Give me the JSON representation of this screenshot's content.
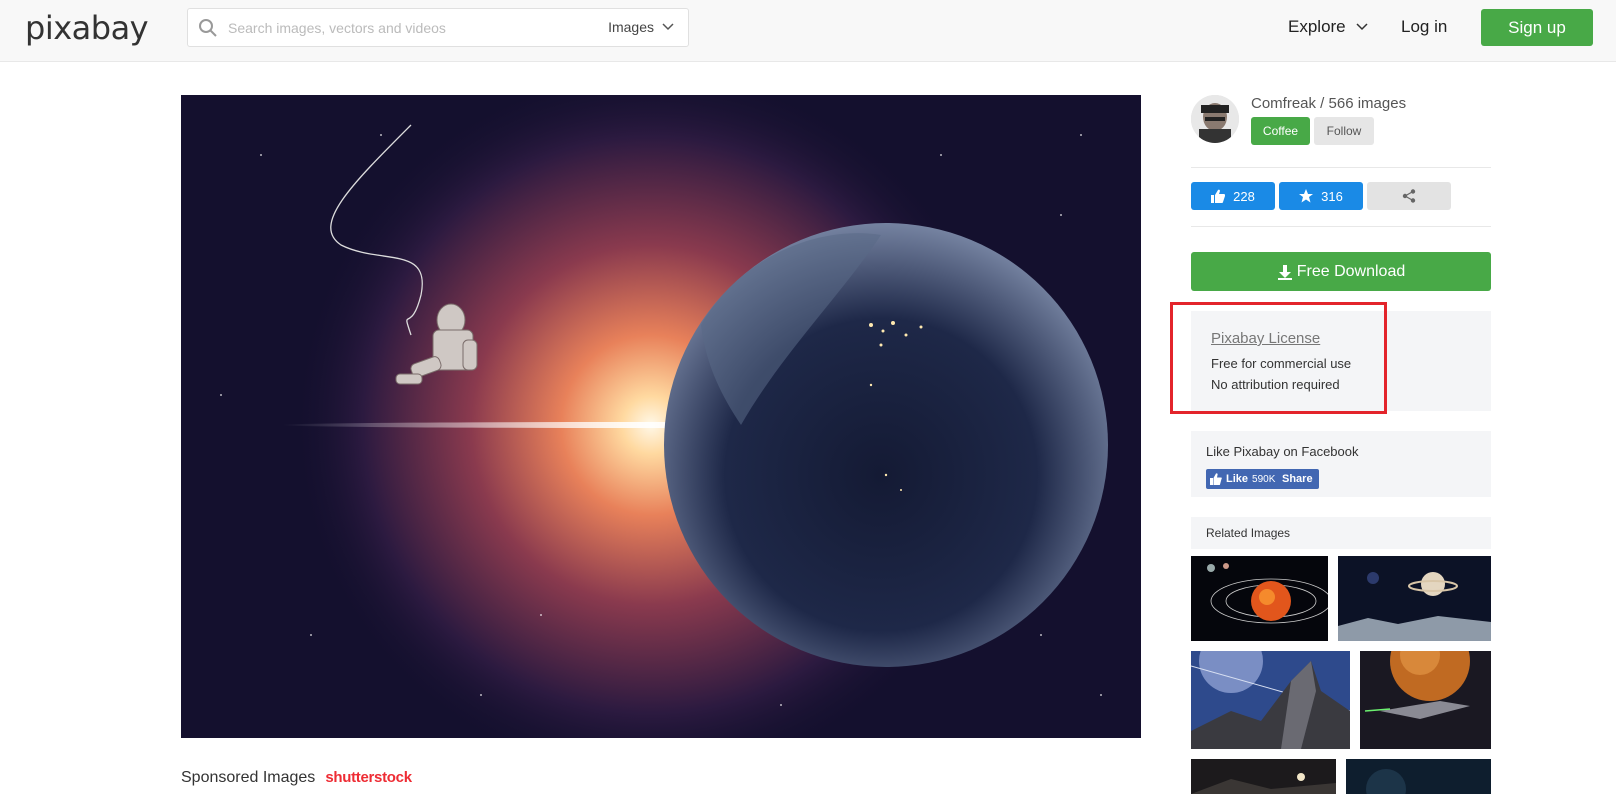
{
  "header": {
    "logo": "pixabay",
    "search_placeholder": "Search images, vectors and videos",
    "search_type": "Images",
    "explore": "Explore",
    "login": "Log in",
    "signup": "Sign up"
  },
  "author": {
    "name_line": "Comfreak / 566 images",
    "coffee": "Coffee",
    "follow": "Follow"
  },
  "stats": {
    "likes": "228",
    "favorites": "316"
  },
  "download": "Free Download",
  "license": {
    "title": "Pixabay License",
    "line1": "Free for commercial use",
    "line2": "No attribution required"
  },
  "facebook": {
    "title": "Like Pixabay on Facebook",
    "like": "Like",
    "count": "590K",
    "share": "Share"
  },
  "related": {
    "title": "Related Images"
  },
  "sponsored": {
    "label": "Sponsored Images",
    "brand": "shutterstock"
  },
  "colors": {
    "brand_green": "#48a947",
    "stat_blue": "#1a8ae6",
    "highlight_red": "#e3242b",
    "facebook_blue": "#4267b2"
  },
  "icons": [
    "search-icon",
    "chevron-down-icon",
    "thumbs-up-icon",
    "star-icon",
    "share-icon",
    "download-icon",
    "facebook-icon"
  ]
}
